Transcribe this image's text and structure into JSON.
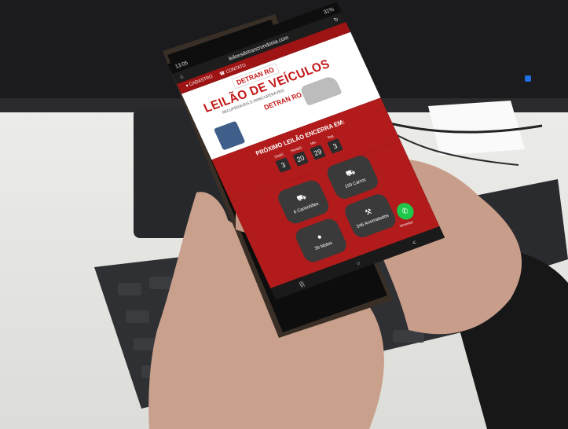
{
  "status_bar": {
    "time": "13:05",
    "battery": "31%"
  },
  "browser": {
    "url": "leiloesdetrancrondonia.com"
  },
  "site_nav": {
    "register": "CADASTRO",
    "contact": "CONTATO"
  },
  "banner": {
    "brand": "DETRAN RO",
    "headline": "LEILÃO DE VEÍCULOS",
    "subheadline": "RECUPERÁVEIS E IRRECUPERÁVEIS",
    "brand_small": "DETRAN RO"
  },
  "countdown": {
    "title": "PRÓXIMO LEILÃO ENCERRA EM:",
    "units": [
      "Dia(s)",
      "Hora(s)",
      "Min.",
      "Seg."
    ],
    "values": [
      "3",
      "20",
      "29",
      "3"
    ]
  },
  "categories": [
    {
      "label": "6 Caminhões",
      "icon": "truck-icon"
    },
    {
      "label": "159 Carros",
      "icon": "car-icon"
    },
    {
      "label": "39 Motos",
      "icon": "motorcycle-icon"
    },
    {
      "label": "346 Arrematados",
      "icon": "gavel-icon"
    }
  ],
  "whatsapp": {
    "label": "WhatsApp"
  }
}
